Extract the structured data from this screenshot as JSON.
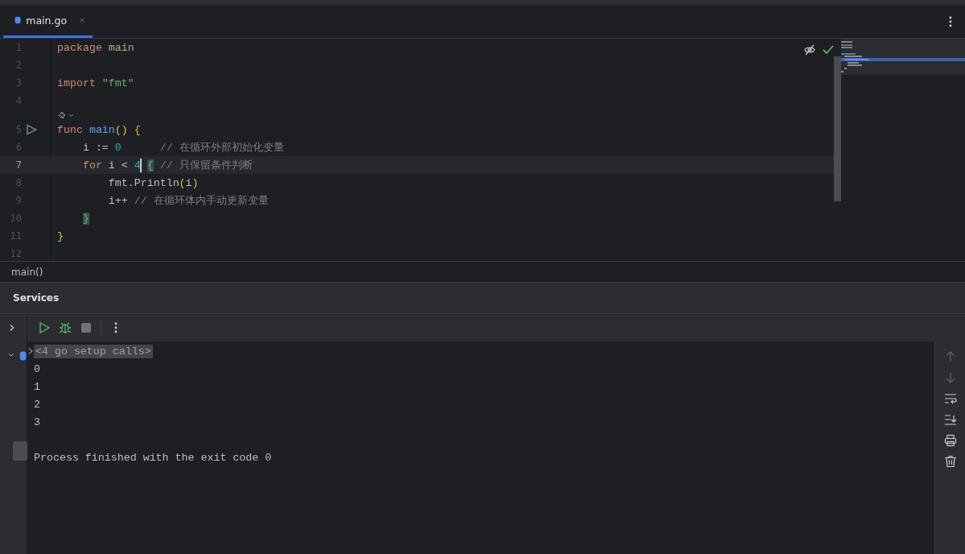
{
  "tabs": [
    {
      "label": "main.go",
      "selected": true
    }
  ],
  "editor": {
    "lines": [
      {
        "number": "1",
        "current": false,
        "tokens": [
          {
            "kind": "keyword",
            "text": "package"
          },
          {
            "kind": "package",
            "text": " main"
          }
        ]
      },
      {
        "number": "2",
        "current": false
      },
      {
        "number": "3",
        "current": false,
        "tokens": [
          {
            "kind": "keyword",
            "text": "import"
          },
          {
            "kind": "string",
            "text": " \"fmt\""
          }
        ]
      },
      {
        "number": "4",
        "current": false
      },
      {
        "number": "5",
        "current": false,
        "run_marker": true,
        "hint_above": true,
        "tokens": [
          {
            "kind": "keyword",
            "text": "func"
          },
          {
            "kind": "function",
            "text": " main"
          },
          {
            "kind": "paren",
            "text": "() {"
          }
        ]
      },
      {
        "number": "6",
        "current": false,
        "tokens": [
          {
            "kind": "plain",
            "text": "    i := "
          },
          {
            "kind": "number",
            "text": "0"
          },
          {
            "kind": "comment",
            "text": "      // 在循环外部初始化变量"
          }
        ]
      },
      {
        "number": "7",
        "current": true,
        "tokens": [
          {
            "kind": "keyword",
            "text": "    for"
          },
          {
            "kind": "plain",
            "text": " i < "
          },
          {
            "kind": "number",
            "text": "4",
            "caret": true
          },
          {
            "kind": "brace_match",
            "text": " {"
          },
          {
            "kind": "comment",
            "text": " // 只保留条件判断"
          }
        ]
      },
      {
        "number": "8",
        "current": false,
        "tokens": [
          {
            "kind": "plain",
            "text": "        fmt.Println"
          },
          {
            "kind": "paren",
            "text": "("
          },
          {
            "kind": "plain",
            "text": "i"
          },
          {
            "kind": "paren",
            "text": ")"
          }
        ]
      },
      {
        "number": "9",
        "current": false,
        "tokens": [
          {
            "kind": "plain",
            "text": "        i++"
          },
          {
            "kind": "comment",
            "text": " // 在循环体内手动更新变量"
          }
        ]
      },
      {
        "number": "10",
        "current": false,
        "tokens": [
          {
            "kind": "brace_match",
            "text": "    }"
          }
        ]
      },
      {
        "number": "11",
        "current": false,
        "tokens": [
          {
            "kind": "paren",
            "text": "}"
          }
        ]
      },
      {
        "number": "12",
        "current": false
      }
    ]
  },
  "breadcrumb": "main()",
  "services": {
    "title": "Services",
    "tree": [
      {
        "expanded": false
      },
      {
        "expanded": true
      }
    ],
    "toolbar": [
      {
        "kind": "run",
        "disabled": false
      },
      {
        "kind": "debug",
        "disabled": false
      },
      {
        "kind": "stop",
        "disabled": true
      },
      {
        "kind": "more",
        "disabled": false
      }
    ],
    "console": [
      {
        "kind": "folded",
        "text": "<4 go setup calls>"
      },
      {
        "kind": "output",
        "text": "0"
      },
      {
        "kind": "output",
        "text": "1"
      },
      {
        "kind": "output",
        "text": "2"
      },
      {
        "kind": "output",
        "text": "3"
      },
      {
        "kind": "exit",
        "text": "Process finished with the exit code 0"
      }
    ],
    "side_toolbar": [
      {
        "kind": "up",
        "disabled": true
      },
      {
        "kind": "down",
        "disabled": true
      },
      {
        "kind": "wrap",
        "disabled": false
      },
      {
        "kind": "scroll-end",
        "disabled": false
      },
      {
        "kind": "print",
        "disabled": false
      },
      {
        "kind": "delete",
        "disabled": false
      }
    ]
  }
}
